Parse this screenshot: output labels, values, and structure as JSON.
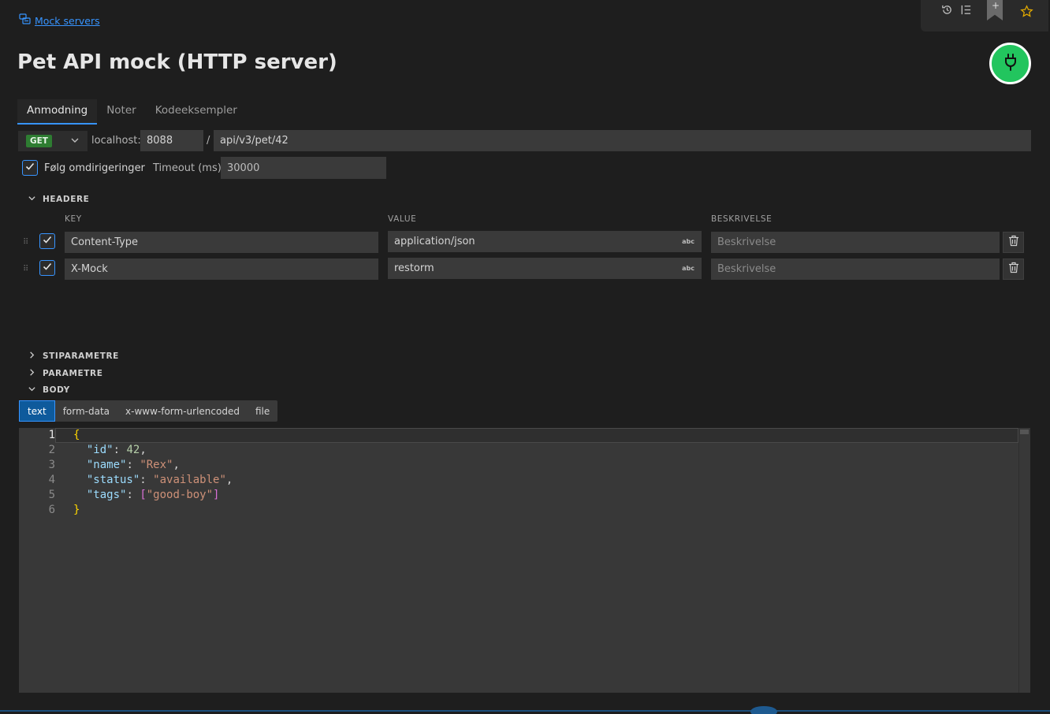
{
  "breadcrumb": {
    "label": "Mock servers"
  },
  "page": {
    "title": "Pet API mock (HTTP server)"
  },
  "tabs": [
    {
      "label": "Anmodning",
      "active": true
    },
    {
      "label": "Noter",
      "active": false
    },
    {
      "label": "Kodeeksempler",
      "active": false
    }
  ],
  "request": {
    "method": "GET",
    "host_label": "localhost:",
    "port": "8088",
    "separator": "/",
    "path": "api/v3/pet/42",
    "follow_redirects_label": "Følg omdirigeringer",
    "follow_redirects": true,
    "timeout_label": "Timeout (ms)",
    "timeout": "30000"
  },
  "headers_section": {
    "title": "HEADERE",
    "columns": {
      "key": "KEY",
      "value": "VALUE",
      "description": "BESKRIVELSE"
    },
    "rows": [
      {
        "enabled": true,
        "key": "Content-Type",
        "value": "application/json",
        "description_placeholder": "Beskrivelse",
        "type_badge": "abc"
      },
      {
        "enabled": true,
        "key": "X-Mock",
        "value": "restorm",
        "description_placeholder": "Beskrivelse",
        "type_badge": "abc"
      }
    ]
  },
  "sections": {
    "path_params": "STIPARAMETRE",
    "params": "PARAMETRE",
    "body": "BODY"
  },
  "body_types": [
    {
      "label": "text",
      "active": true
    },
    {
      "label": "form-data",
      "active": false
    },
    {
      "label": "x-www-form-urlencoded",
      "active": false
    },
    {
      "label": "file",
      "active": false
    }
  ],
  "editor": {
    "line_numbers": [
      "1",
      "2",
      "3",
      "4",
      "5",
      "6"
    ],
    "lines": [
      "{",
      "  \"id\": 42,",
      "  \"name\": \"Rex\",",
      "  \"status\": \"available\",",
      "  \"tags\": [\"good-boy\"]",
      "}"
    ]
  },
  "colors": {
    "accent": "#3794ff",
    "server_running": "#22c55e",
    "method_get": "#2e7d32"
  }
}
